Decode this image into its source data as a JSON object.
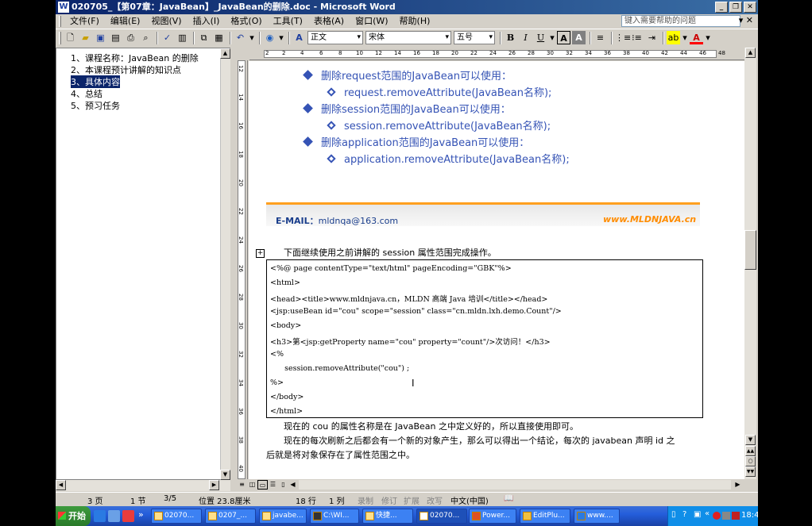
{
  "window": {
    "title": "020705_【第07章：JavaBean】_JavaBean的删除.doc - Microsoft Word",
    "app_icon": "W"
  },
  "menu": {
    "items": [
      "文件(F)",
      "编辑(E)",
      "视图(V)",
      "插入(I)",
      "格式(O)",
      "工具(T)",
      "表格(A)",
      "窗口(W)",
      "帮助(H)"
    ],
    "help_placeholder": "键入需要帮助的问题"
  },
  "toolbar": {
    "style": "正文",
    "font": "宋体",
    "size": "五号"
  },
  "outline": [
    "1、课程名称：JavaBean 的删除",
    "2、本课程预计讲解的知识点",
    "3、具体内容",
    "4、总结",
    "5、预习任务"
  ],
  "ruler_h": [
    "2",
    "2",
    "4",
    "6",
    "8",
    "10",
    "12",
    "14",
    "16",
    "18",
    "20",
    "22",
    "24",
    "26",
    "28",
    "30",
    "32",
    "34",
    "36",
    "38",
    "40",
    "42",
    "44",
    "46",
    "48"
  ],
  "ruler_v": [
    "12",
    "14",
    "16",
    "18",
    "20",
    "22",
    "24",
    "26",
    "28",
    "30",
    "32",
    "34",
    "36",
    "38",
    "40"
  ],
  "slide": {
    "lines": [
      {
        "level": 1,
        "text": "删除request范围的JavaBean可以使用："
      },
      {
        "level": 2,
        "text": "request.removeAttribute(JavaBean名称);"
      },
      {
        "level": 1,
        "text": "删除session范围的JavaBean可以使用："
      },
      {
        "level": 2,
        "text": "session.removeAttribute(JavaBean名称);"
      },
      {
        "level": 1,
        "text": "删除application范围的JavaBean可以使用："
      },
      {
        "level": 2,
        "text": "application.removeAttribute(JavaBean名称);"
      }
    ],
    "email_label": "E-MAIL：",
    "email": "mldnqa@163.com",
    "site": "www.MLDNJAVA.cn"
  },
  "intro": "下面继续使用之前讲解的 session 属性范围完成操作。",
  "code": [
    "<%@ page contentType=\"text/html\" pageEncoding=\"GBK\"%>",
    "<html>",
    "<head><title>www.mldnjava.cn，MLDN 高端 Java 培训</title></head>",
    "<jsp:useBean id=\"cou\" scope=\"session\" class=\"cn.mldn.lxh.demo.Count\"/>",
    "<body>",
    "<h3>第<jsp:getProperty name=\"cou\" property=\"count\"/>次访问！</h3>",
    "<%",
    "      session.removeAttribute(\"cou\") ;",
    "%>",
    "</body>",
    "</html>"
  ],
  "para1": "现在的 cou 的属性名称是在 JavaBean 之中定义好的，所以直接使用即可。",
  "para2a": "现在的每次刷新之后都会有一个新的对象产生，那么可以得出一个结论，每次的 javabean 声明 id 之",
  "para2b": "后就是将对象保存在了属性范围之中。",
  "status": {
    "page": "3 页",
    "section": "1 节",
    "pages": "3/5",
    "position": "位置 23.8厘米",
    "line": "18 行",
    "col": "1 列",
    "rec": "录制",
    "trk": "修订",
    "ext": "扩展",
    "ovr": "改写",
    "lang": "中文(中国)"
  },
  "taskbar": {
    "start": "开始",
    "buttons": [
      "02070...",
      "0207_...",
      "javabe...",
      "C:\\WI...",
      "快捷...",
      "02070...",
      "Power...",
      "EditPlu...",
      "www...."
    ],
    "clock": "18:42"
  }
}
